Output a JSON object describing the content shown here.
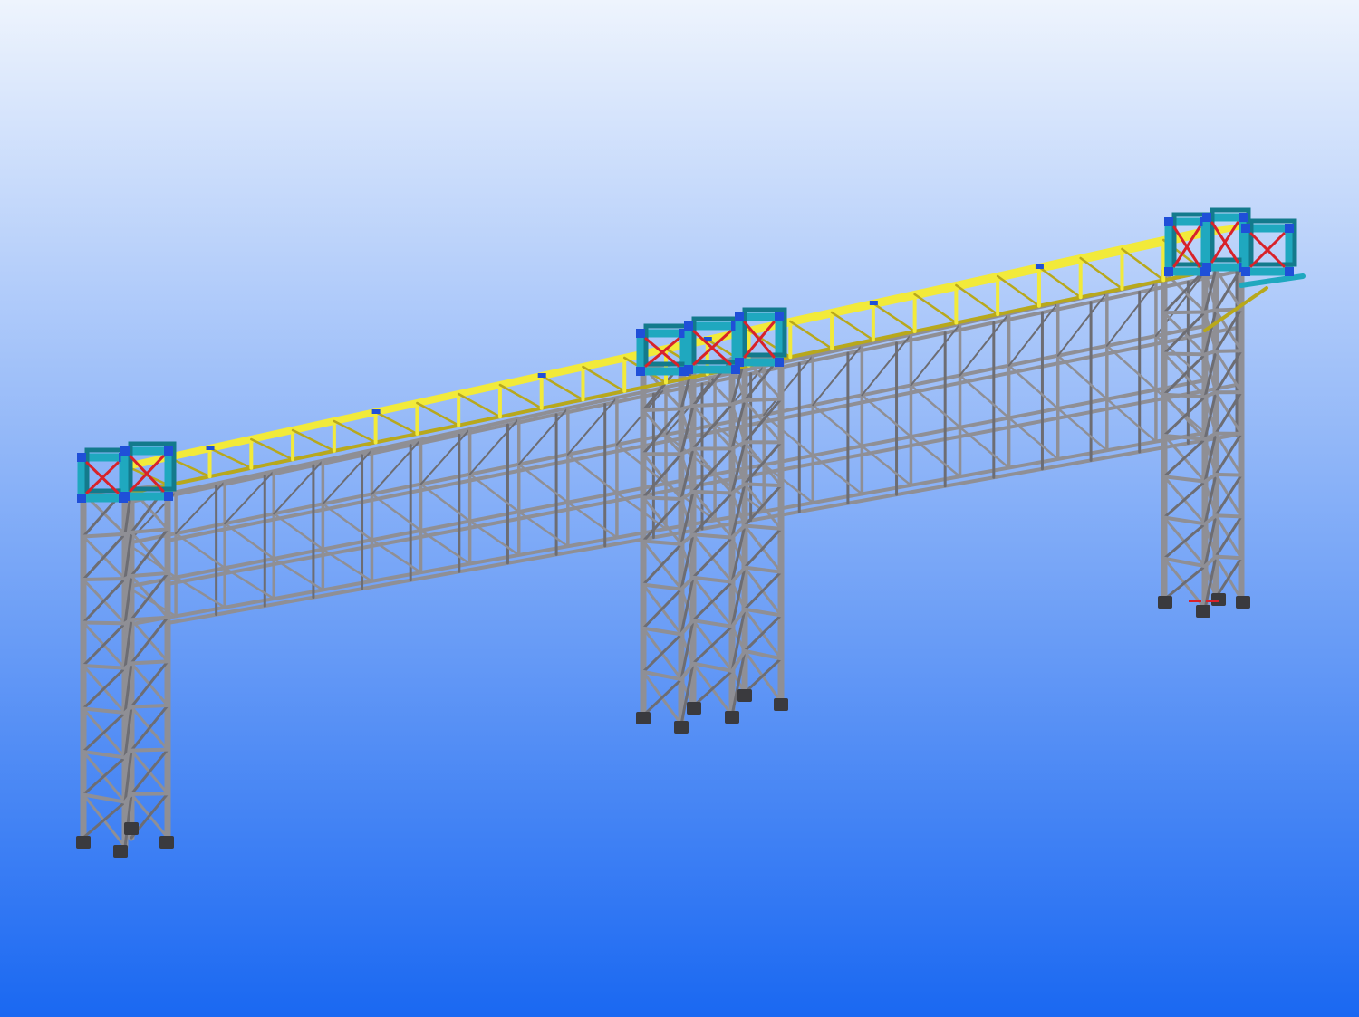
{
  "viewport": {
    "background_top": "#eef4fd",
    "background_bottom": "#1a68f2"
  },
  "colors": {
    "steel_grey": "#8f8f95",
    "steel_grey_dark": "#6d6d73",
    "walkway_yellow": "#f2ea3a",
    "walkway_yellow_dark": "#b8a81c",
    "portal_cyan": "#1fa8bf",
    "portal_cyan_dark": "#137a8c",
    "bracing_red": "#d8222a",
    "connection_blue": "#1f4fd8",
    "base_plate": "#3a3a3e"
  },
  "model": {
    "towers": [
      {
        "id": "left",
        "legs": 4
      },
      {
        "id": "middle",
        "legs": 6
      },
      {
        "id": "right",
        "legs": 4
      }
    ],
    "bridge_spans": 2,
    "has_cantilever": true
  }
}
